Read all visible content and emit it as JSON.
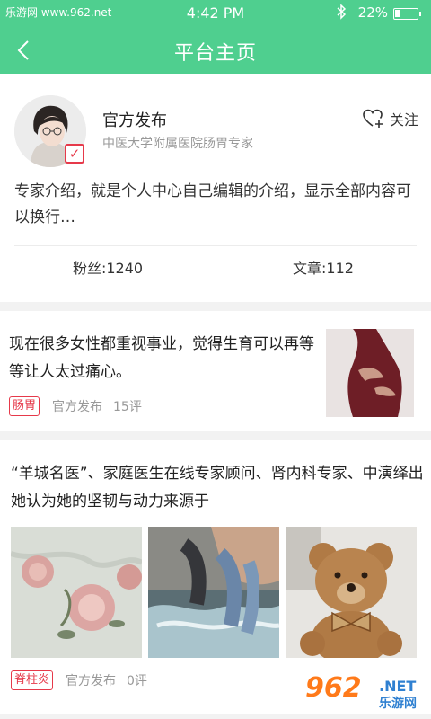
{
  "status_bar": {
    "watermark_text": "乐游网 www.962.net",
    "time": "4:42 PM",
    "bluetooth_icon": "bluetooth-icon",
    "battery_percent": "22%",
    "battery_level": 0.22
  },
  "nav": {
    "back_icon": "chevron-left-icon",
    "title": "平台主页"
  },
  "profile": {
    "name": "官方发布",
    "title": "中医大学附属医院肠胃专家",
    "follow_label": "关注",
    "follow_icon": "heart-plus-icon",
    "verified_icon": "checkbox-checked-icon",
    "intro": "专家介绍，就是个人中心自己编辑的介绍，显示全部内容可以换行…",
    "fans": "粉丝:1240",
    "articles": "文章:112"
  },
  "posts": [
    {
      "text": "现在很多女性都重视事业，觉得生育可以再等等让人太过痛心。",
      "tag": "肠胃",
      "source": "官方发布",
      "comments": "15评"
    },
    {
      "text": "“羊城名医”、家庭医生在线专家顾问、肾内科专家、中演绎出她认为她的坚韧与动力来源于",
      "tag": "脊柱炎",
      "source": "官方发布",
      "comments": "0评"
    }
  ],
  "corner_logo": {
    "number": "962",
    "suffix": ".NET",
    "cn": "乐游网"
  },
  "colors": {
    "accent": "#4fcf8f",
    "tag_red": "#e6394a",
    "muted_text": "#999999"
  }
}
